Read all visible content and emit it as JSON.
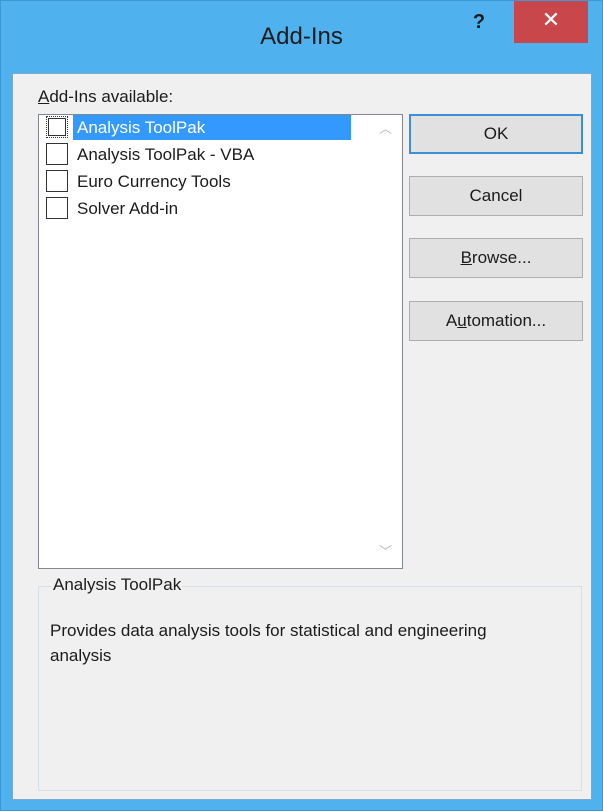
{
  "window": {
    "title": "Add-Ins",
    "help_label": "?",
    "close_label": "✕"
  },
  "addins": {
    "label_prefix": "A",
    "label_rest": "dd-Ins available:",
    "items": [
      {
        "label": "Analysis ToolPak",
        "checked": false,
        "selected": true
      },
      {
        "label": "Analysis ToolPak - VBA",
        "checked": false,
        "selected": false
      },
      {
        "label": "Euro Currency Tools",
        "checked": false,
        "selected": false
      },
      {
        "label": "Solver Add-in",
        "checked": false,
        "selected": false
      }
    ],
    "scroll_up": "︿",
    "scroll_down": "﹀"
  },
  "buttons": {
    "ok": "OK",
    "cancel": "Cancel",
    "browse_mnemonic": "B",
    "browse_rest": "rowse...",
    "automation_pre": "A",
    "automation_mnemonic": "u",
    "automation_rest": "tomation..."
  },
  "details": {
    "title": "Analysis ToolPak",
    "description": "Provides data analysis tools for statistical and engineering analysis"
  },
  "colors": {
    "title_bar": "#4fb2ee",
    "close_button": "#c9474a",
    "selection": "#3399ff",
    "default_button_border": "#3c8fd6"
  }
}
